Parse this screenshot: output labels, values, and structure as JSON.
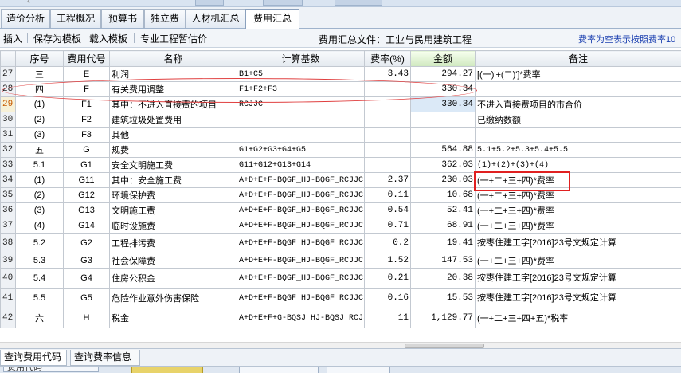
{
  "tabs": [
    {
      "label": "造价分析",
      "active": false
    },
    {
      "label": "工程概况",
      "active": false
    },
    {
      "label": "预算书",
      "active": false
    },
    {
      "label": "独立费",
      "active": false
    },
    {
      "label": "人材机汇总",
      "active": false
    },
    {
      "label": "费用汇总",
      "active": true
    }
  ],
  "toolbar": {
    "insert": "插入",
    "save_template": "保存为模板",
    "load_template": "载入模板",
    "special_provisional": "专业工程暂估价",
    "file_label": "费用汇总文件：工业与民用建筑工程",
    "rate_hint": "费率为空表示按照费率10"
  },
  "columns": {
    "rownum": "",
    "seq": "序号",
    "code": "费用代号",
    "name": "名称",
    "base": "计算基数",
    "rate": "费率(%)",
    "amount": "金额",
    "note": "备注"
  },
  "rows": [
    {
      "num": "27",
      "seq": "三",
      "code": "E",
      "name": "利润",
      "base": "B1+C5",
      "rate": "3.43",
      "amount": "294.27",
      "note": "[(一)'+(二)']*费率"
    },
    {
      "num": "28",
      "seq": "四",
      "code": "F",
      "name": "有关费用调整",
      "base": "F1+F2+F3",
      "rate": "",
      "amount": "330.34",
      "note": ""
    },
    {
      "num": "29",
      "seq": "(1)",
      "code": "F1",
      "name": "其中：不进入直接费的项目",
      "base": "RCJJC",
      "rate": "",
      "amount": "330.34",
      "note": "不进入直接费项目的市合价",
      "selected": true
    },
    {
      "num": "30",
      "seq": "(2)",
      "code": "F2",
      "name": "建筑垃圾处置费用",
      "base": "",
      "rate": "",
      "amount": "",
      "note": "已缴纳数额"
    },
    {
      "num": "31",
      "seq": "(3)",
      "code": "F3",
      "name": "其他",
      "base": "",
      "rate": "",
      "amount": "",
      "note": ""
    },
    {
      "num": "32",
      "seq": "五",
      "code": "G",
      "name": "规费",
      "base": "G1+G2+G3+G4+G5",
      "rate": "",
      "amount": "564.88",
      "note": "5.1+5.2+5.3+5.4+5.5"
    },
    {
      "num": "33",
      "seq": "5.1",
      "code": "G1",
      "name": "安全文明施工费",
      "base": "G11+G12+G13+G14",
      "rate": "",
      "amount": "362.03",
      "note": "(1)+(2)+(3)+(4)"
    },
    {
      "num": "34",
      "seq": "(1)",
      "code": "G11",
      "name": "其中：安全施工费",
      "base": "A+D+E+F-BQGF_HJ-BQGF_RCJJC",
      "rate": "2.37",
      "amount": "230.03",
      "note": "(一+二+三+四)*费率"
    },
    {
      "num": "35",
      "seq": "(2)",
      "code": "G12",
      "name": "环境保护费",
      "base": "A+D+E+F-BQGF_HJ-BQGF_RCJJC",
      "rate": "0.11",
      "amount": "10.68",
      "note": "(一+二+三+四)*费率"
    },
    {
      "num": "36",
      "seq": "(3)",
      "code": "G13",
      "name": "文明施工费",
      "base": "A+D+E+F-BQGF_HJ-BQGF_RCJJC",
      "rate": "0.54",
      "amount": "52.41",
      "note": "(一+二+三+四)*费率"
    },
    {
      "num": "37",
      "seq": "(4)",
      "code": "G14",
      "name": "临时设施费",
      "base": "A+D+E+F-BQGF_HJ-BQGF_RCJJC",
      "rate": "0.71",
      "amount": "68.91",
      "note": "(一+二+三+四)*费率"
    },
    {
      "num": "38",
      "seq": "5.2",
      "code": "G2",
      "name": "工程排污费",
      "base": "A+D+E+F-BQGF_HJ-BQGF_RCJJC",
      "rate": "0.2",
      "amount": "19.41",
      "note": "按枣住建工字[2016]23号文规定计算",
      "tall": true
    },
    {
      "num": "39",
      "seq": "5.3",
      "code": "G3",
      "name": "社会保障费",
      "base": "A+D+E+F-BQGF_HJ-BQGF_RCJJC",
      "rate": "1.52",
      "amount": "147.53",
      "note": "(一+二+三+四)*费率"
    },
    {
      "num": "40",
      "seq": "5.4",
      "code": "G4",
      "name": "住房公积金",
      "base": "A+D+E+F-BQGF_HJ-BQGF_RCJJC",
      "rate": "0.21",
      "amount": "20.38",
      "note": "按枣住建工字[2016]23号文规定计算",
      "tall": true
    },
    {
      "num": "41",
      "seq": "5.5",
      "code": "G5",
      "name": "危险作业意外伤害保险",
      "base": "A+D+E+F-BQGF_HJ-BQGF_RCJJC",
      "rate": "0.16",
      "amount": "15.53",
      "note": "按枣住建工字[2016]23号文规定计算",
      "tall": true
    },
    {
      "num": "42",
      "seq": "六",
      "code": "H",
      "name": "税金",
      "base": "A+D+E+F+G-BQSJ_HJ-BQSJ_RCJJC-JGCLF_SCJ-JGZCF_SCJ",
      "rate": "11",
      "amount": "1,129.77",
      "note": "(一+二+三+四+五)*税率",
      "tall": true
    }
  ],
  "bottom_tabs": [
    {
      "label": "查询费用代码",
      "active": true
    },
    {
      "label": "查询费率信息",
      "active": false
    }
  ],
  "footer": {
    "partial_label": "费用代码"
  },
  "colors": {
    "accent_amount_header": "#cfe8bf",
    "highlight_red": "#e02020",
    "selected_rownum": "#c75a00"
  }
}
